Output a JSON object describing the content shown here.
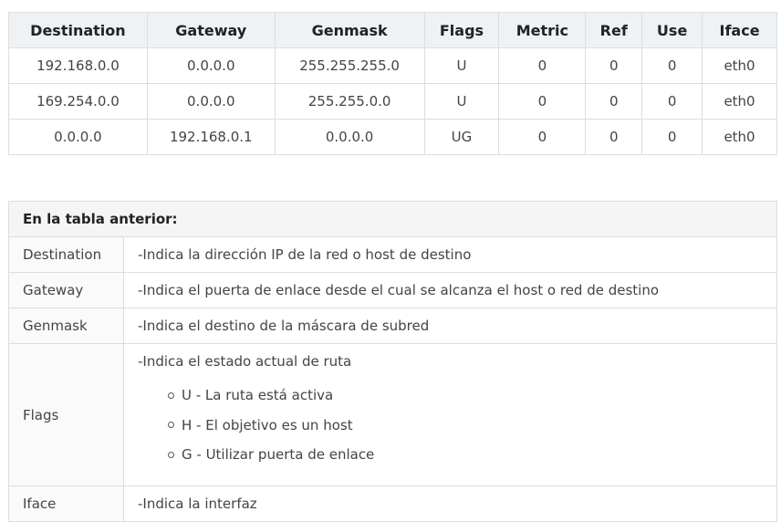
{
  "route_table": {
    "headers": [
      "Destination",
      "Gateway",
      "Genmask",
      "Flags",
      "Metric",
      "Ref",
      "Use",
      "Iface"
    ],
    "rows": [
      [
        "192.168.0.0",
        "0.0.0.0",
        "255.255.255.0",
        "U",
        "0",
        "0",
        "0",
        "eth0"
      ],
      [
        "169.254.0.0",
        "0.0.0.0",
        "255.255.0.0",
        "U",
        "0",
        "0",
        "0",
        "eth0"
      ],
      [
        "0.0.0.0",
        "192.168.0.1",
        "0.0.0.0",
        "UG",
        "0",
        "0",
        "0",
        "eth0"
      ]
    ]
  },
  "desc_table": {
    "title": "En la tabla anterior:",
    "rows": [
      {
        "term": "Destination",
        "desc": "-Indica la dirección IP de la red o host de destino"
      },
      {
        "term": "Gateway",
        "desc": "-Indica el puerta de enlace desde el cual se alcanza el host o red de destino"
      },
      {
        "term": "Genmask",
        "desc": "-Indica el destino de la máscara de subred"
      },
      {
        "term": "Flags",
        "desc": "-Indica el estado actual de ruta",
        "items": [
          "U - La ruta está activa",
          "H - El objetivo es un host",
          "G - Utilizar puerta de enlace"
        ]
      },
      {
        "term": "Iface",
        "desc": "-Indica la interfaz"
      }
    ]
  }
}
